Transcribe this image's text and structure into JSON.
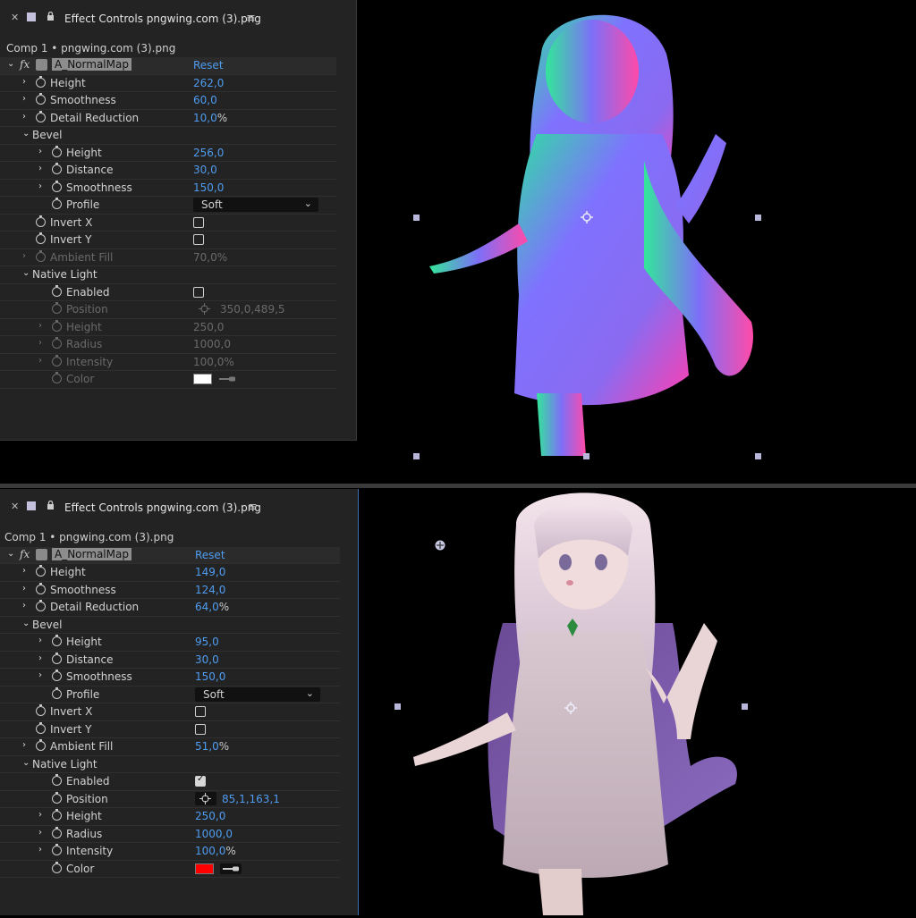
{
  "panels": [
    {
      "tab_title": "Effect Controls pngwing.com (3).png",
      "comp_label": "Comp 1 • pngwing.com (3).png",
      "effect": {
        "fx": "fx",
        "name": "A_NormalMap",
        "reset": "Reset"
      },
      "height": {
        "label": "Height",
        "value": "262,0"
      },
      "smoothness": {
        "label": "Smoothness",
        "value": "60,0"
      },
      "detail_reduction": {
        "label": "Detail Reduction",
        "value": "10,0",
        "unit": "%"
      },
      "bevel": {
        "label": "Bevel",
        "height": {
          "label": "Height",
          "value": "256,0"
        },
        "distance": {
          "label": "Distance",
          "value": "30,0"
        },
        "smoothness": {
          "label": "Smoothness",
          "value": "150,0"
        },
        "profile": {
          "label": "Profile",
          "value": "Soft"
        }
      },
      "invert_x": {
        "label": "Invert X",
        "checked": false
      },
      "invert_y": {
        "label": "Invert Y",
        "checked": false
      },
      "ambient_fill": {
        "label": "Ambient Fill",
        "value": "70,0",
        "unit": "%"
      },
      "native_light": {
        "label": "Native Light",
        "enabled": {
          "label": "Enabled",
          "checked": false
        },
        "position": {
          "label": "Position",
          "value": "350,0,489,5"
        },
        "height": {
          "label": "Height",
          "value": "250,0"
        },
        "radius": {
          "label": "Radius",
          "value": "1000,0"
        },
        "intensity": {
          "label": "Intensity",
          "value": "100,0",
          "unit": "%"
        },
        "color": {
          "label": "Color",
          "value": "#ffffff"
        }
      }
    },
    {
      "tab_title": "Effect Controls pngwing.com (3).png",
      "comp_label": "Comp 1 • pngwing.com (3).png",
      "effect": {
        "fx": "fx",
        "name": "A_NormalMap",
        "reset": "Reset"
      },
      "height": {
        "label": "Height",
        "value": "149,0"
      },
      "smoothness": {
        "label": "Smoothness",
        "value": "124,0"
      },
      "detail_reduction": {
        "label": "Detail Reduction",
        "value": "64,0",
        "unit": "%"
      },
      "bevel": {
        "label": "Bevel",
        "height": {
          "label": "Height",
          "value": "95,0"
        },
        "distance": {
          "label": "Distance",
          "value": "30,0"
        },
        "smoothness": {
          "label": "Smoothness",
          "value": "150,0"
        },
        "profile": {
          "label": "Profile",
          "value": "Soft"
        }
      },
      "invert_x": {
        "label": "Invert X",
        "checked": false
      },
      "invert_y": {
        "label": "Invert Y",
        "checked": false
      },
      "ambient_fill": {
        "label": "Ambient Fill",
        "value": "51,0",
        "unit": "%"
      },
      "native_light": {
        "label": "Native Light",
        "enabled": {
          "label": "Enabled",
          "checked": true
        },
        "position": {
          "label": "Position",
          "value": "85,1,163,1"
        },
        "height": {
          "label": "Height",
          "value": "250,0"
        },
        "radius": {
          "label": "Radius",
          "value": "1000,0"
        },
        "intensity": {
          "label": "Intensity",
          "value": "100,0",
          "unit": "%"
        },
        "color": {
          "label": "Color",
          "value": "#ff0000"
        }
      }
    }
  ],
  "colors": {
    "panel_bg": "#232323",
    "value_blue": "#4f9cf0",
    "handle": "#b9b7d9",
    "active_border": "#3b6fb0"
  },
  "icons": [
    "close-icon",
    "panel-square-icon",
    "lock-icon",
    "panel-menu-icon",
    "chevron-right-icon",
    "chevron-down-icon",
    "stopwatch-icon",
    "effect-toggle-icon",
    "crosshair-icon",
    "eyedropper-icon",
    "checkbox-icon"
  ]
}
